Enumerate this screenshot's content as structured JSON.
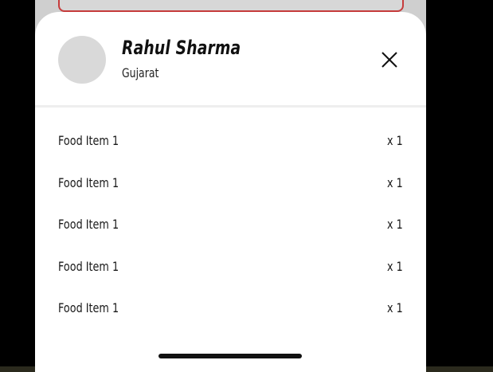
{
  "user": {
    "name": "Rahul Sharma",
    "location": "Gujarat"
  },
  "items": [
    {
      "name": "Food Item 1",
      "qty": "x 1"
    },
    {
      "name": "Food Item 1",
      "qty": "x 1"
    },
    {
      "name": "Food Item 1",
      "qty": "x 1"
    },
    {
      "name": "Food Item 1",
      "qty": "x 1"
    },
    {
      "name": "Food Item 1",
      "qty": "x 1"
    }
  ],
  "icons": {
    "close": "close-icon"
  },
  "colors": {
    "card_border": "#c63b3b",
    "sheet_background": "#ffffff",
    "avatar_placeholder": "#d9d9d9"
  }
}
